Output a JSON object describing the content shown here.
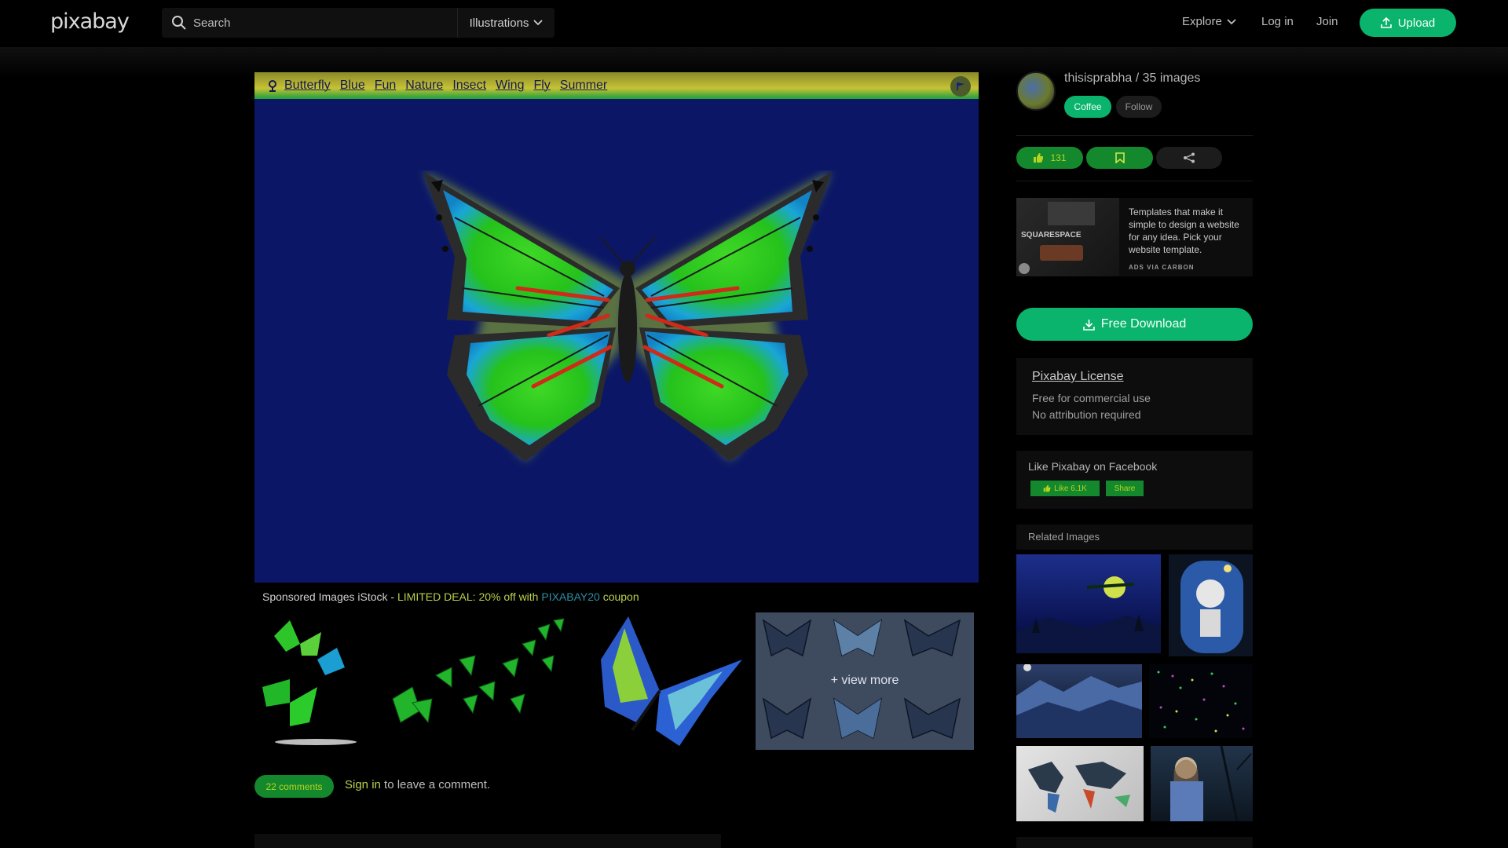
{
  "header": {
    "logo": "pixabay",
    "search_placeholder": "Search",
    "search_type": "Illustrations",
    "explore": "Explore",
    "login": "Log in",
    "join": "Join",
    "upload": "Upload"
  },
  "image": {
    "tags": [
      "Butterfly",
      "Blue",
      "Fun",
      "Nature",
      "Insect",
      "Wing",
      "Fly",
      "Summer"
    ]
  },
  "sponsored": {
    "prefix": "Sponsored Images iStock - ",
    "deal": "LIMITED DEAL: 20% off with ",
    "code": "PIXABAY20",
    "suffix": " coupon",
    "view_more": "+ view more"
  },
  "comments": {
    "count_label": "22 comments",
    "signin_link": "Sign in",
    "signin_rest": " to leave a comment."
  },
  "sidebar": {
    "username": "thisisprabha / 35 images",
    "coffee": "Coffee",
    "follow": "Follow",
    "likes": "131",
    "ad_text": "Templates that make it simple to design a website for any idea. Pick your website template.",
    "ad_brand": "SQUARESPACE",
    "ad_via": "ADS VIA CARBON",
    "download": "Free Download",
    "license_title": "Pixabay License",
    "license_line1": "Free for commercial use",
    "license_line2": "No attribution required",
    "fb_title": "Like Pixabay on Facebook",
    "fb_like": "Like 6.1K",
    "fb_share": "Share",
    "related_title": "Related Images"
  },
  "colors": {
    "accent": "#0ab46d",
    "like_bg": "#14882d",
    "image_bg": "#0b1766"
  }
}
